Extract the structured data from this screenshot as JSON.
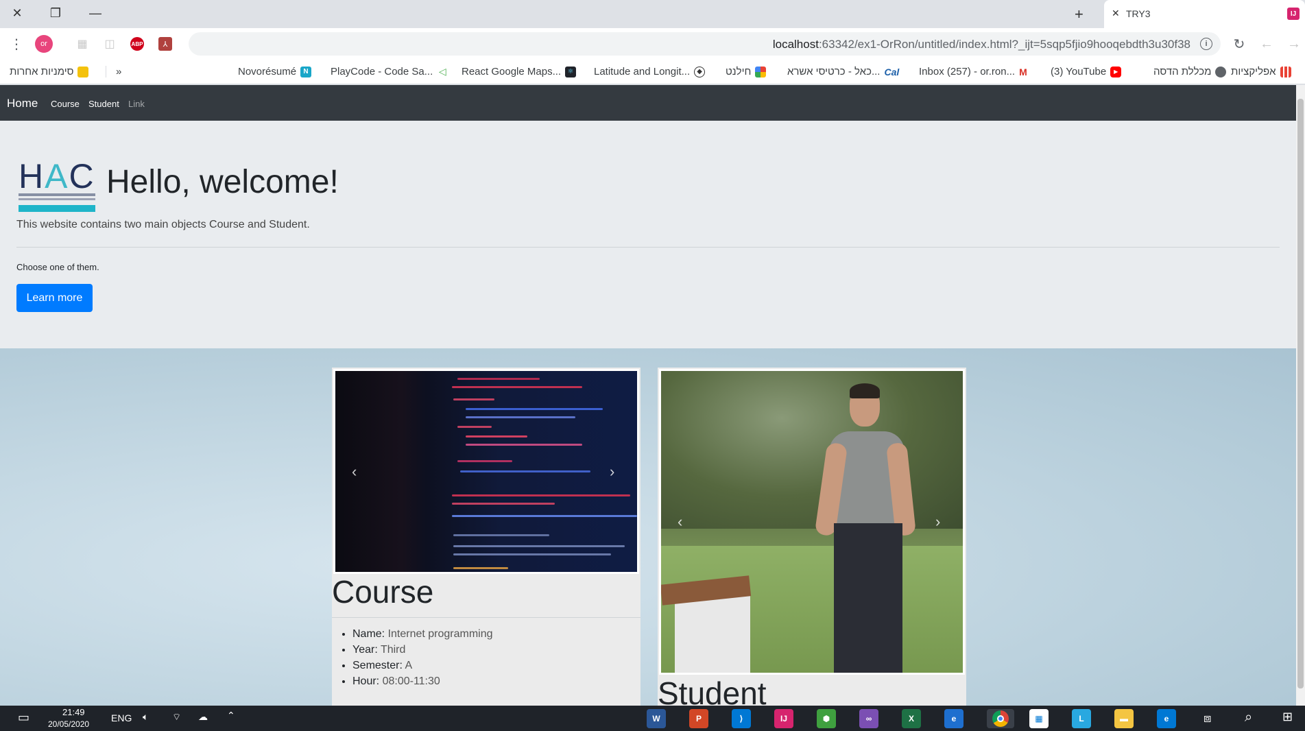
{
  "browser": {
    "tab_title": "TRY3",
    "tab_favicon": "IJ",
    "url_host": "localhost",
    "url_path": ":63342/ex1-OrRon/untitled/index.html?_ijt=5sqp5fjio9hooqebdth3u30f38",
    "profile_initials": "or"
  },
  "bookmarks": {
    "items": [
      {
        "label": "סימניות אחרות",
        "icon": "folder-icon",
        "color": "#f4c20d"
      },
      {
        "label": "»",
        "icon": "",
        "color": ""
      },
      {
        "label": "Novorésumé",
        "icon": "novoresume-icon",
        "color": "#19a6c8"
      },
      {
        "label": "PlayCode - Code Sa...",
        "icon": "playcode-icon",
        "color": "#4caf50"
      },
      {
        "label": "React Google Maps...",
        "icon": "react-icon",
        "color": "#20232a"
      },
      {
        "label": "Latitude and Longit...",
        "icon": "compass-icon",
        "color": "#333333"
      },
      {
        "label": "חילנט",
        "icon": "hilnet-icon",
        "color": "#e94235"
      },
      {
        "label": "כאל - כרטיסי אשרא...",
        "icon": "cal-icon",
        "color": "#1a5ea8"
      },
      {
        "label": "Inbox (257) - or.ron...",
        "icon": "gmail-icon",
        "color": "#d93025"
      },
      {
        "label": "(3) YouTube",
        "icon": "youtube-icon",
        "color": "#ff0000"
      },
      {
        "label": "מכללת הדסה",
        "icon": "globe-icon",
        "color": "#5f6368"
      },
      {
        "label": "אפליקציות",
        "icon": "apps-grid-icon",
        "color": "#e94235"
      }
    ]
  },
  "nav": {
    "brand": "Home",
    "links": [
      "Course",
      "Student",
      "Link"
    ]
  },
  "jumbotron": {
    "logo_text": "HAC",
    "heading": "Hello, welcome!",
    "lead": "This website contains two main objects Course and Student.",
    "sub": "Choose one of them.",
    "button": "Learn more"
  },
  "course": {
    "title": "Course",
    "details": [
      {
        "key": "Name:",
        "value": " Internet programming"
      },
      {
        "key": "Year:",
        "value": " Third"
      },
      {
        "key": "Semester:",
        "value": " A"
      },
      {
        "key": "Hour:",
        "value": " 08:00-11:30"
      }
    ]
  },
  "student": {
    "title": "Student"
  },
  "taskbar": {
    "time": "21:49",
    "date": "20/05/2020",
    "lang": "ENG"
  }
}
